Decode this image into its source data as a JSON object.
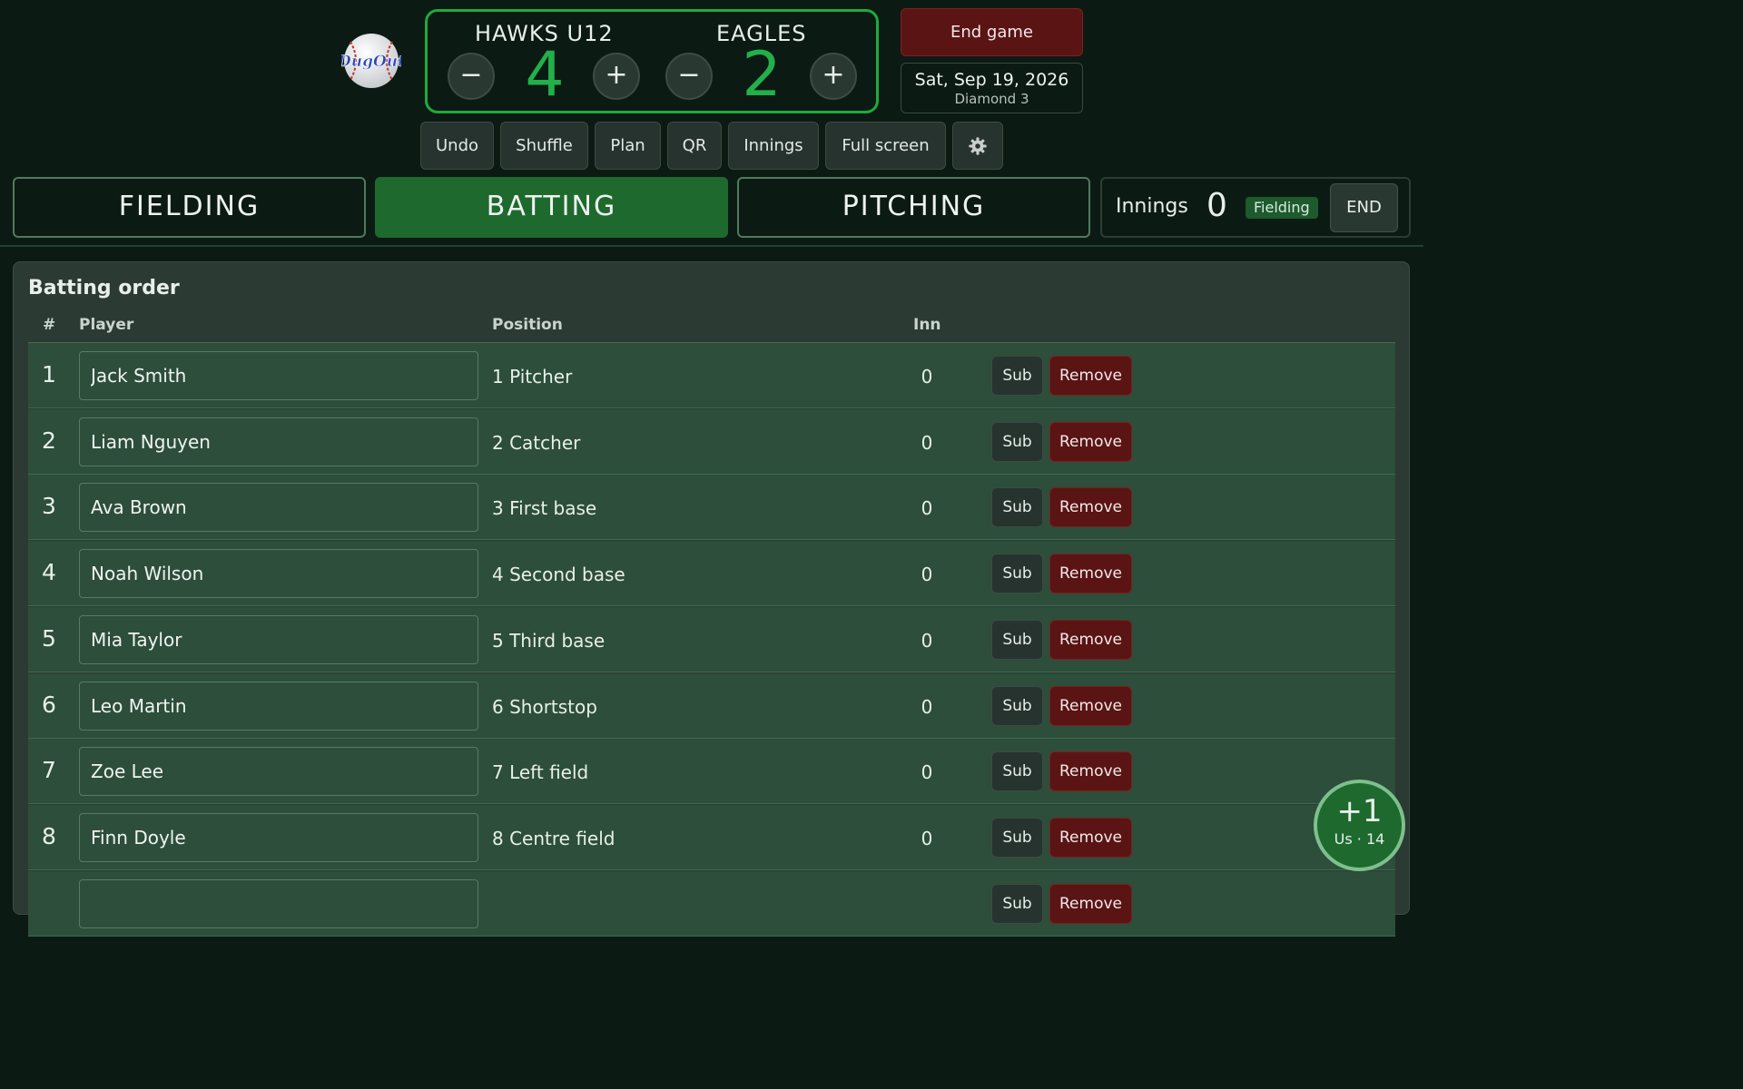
{
  "header": {
    "home": {
      "name": "HAWKS U12",
      "score": "4"
    },
    "away": {
      "name": "EAGLES",
      "score": "2"
    },
    "minus_label": "−",
    "plus_label": "+",
    "end_game_label": "End game",
    "date": "Sat, Sep 19, 2026",
    "venue": "Diamond 3",
    "logo_text": "DugOut"
  },
  "toolbar": {
    "undo": "Undo",
    "shuffle": "Shuffle",
    "plan": "Plan",
    "qr": "QR",
    "innings": "Innings",
    "fullscreen": "Full screen"
  },
  "tabs": {
    "fielding": "FIELDING",
    "batting": "BATTING",
    "pitching": "PITCHING",
    "active": "batting"
  },
  "innings_panel": {
    "label": "Innings",
    "value": "0",
    "badge": "Fielding",
    "end_label": "END"
  },
  "batting_order": {
    "title": "Batting order",
    "columns": {
      "num": "#",
      "player": "Player",
      "position": "Position",
      "inn": "Inn"
    },
    "sub_label": "Sub",
    "remove_label": "Remove",
    "rows": [
      {
        "num": "1",
        "player": "Jack Smith",
        "position": "1 Pitcher",
        "inn": "0"
      },
      {
        "num": "2",
        "player": "Liam Nguyen",
        "position": "2 Catcher",
        "inn": "0"
      },
      {
        "num": "3",
        "player": "Ava Brown",
        "position": "3 First base",
        "inn": "0"
      },
      {
        "num": "4",
        "player": "Noah Wilson",
        "position": "4 Second base",
        "inn": "0"
      },
      {
        "num": "5",
        "player": "Mia Taylor",
        "position": "5 Third base",
        "inn": "0"
      },
      {
        "num": "6",
        "player": "Leo Martin",
        "position": "6 Shortstop",
        "inn": "0"
      },
      {
        "num": "7",
        "player": "Zoe Lee",
        "position": "7 Left field",
        "inn": "0"
      },
      {
        "num": "8",
        "player": "Finn Doyle",
        "position": "8 Centre field",
        "inn": "0"
      },
      {
        "num": "",
        "player": "",
        "position": "",
        "inn": ""
      }
    ]
  },
  "fab": {
    "main": "+1",
    "sub": "Us · 14"
  },
  "colors": {
    "background": "#0c1a14",
    "accent_green": "#22b04a",
    "active_tab": "#1e6a2e",
    "danger": "#5a1414",
    "row_bg": "#2c4e3a"
  },
  "icons": {
    "settings": "gear-icon",
    "logo": "baseball-logo"
  }
}
